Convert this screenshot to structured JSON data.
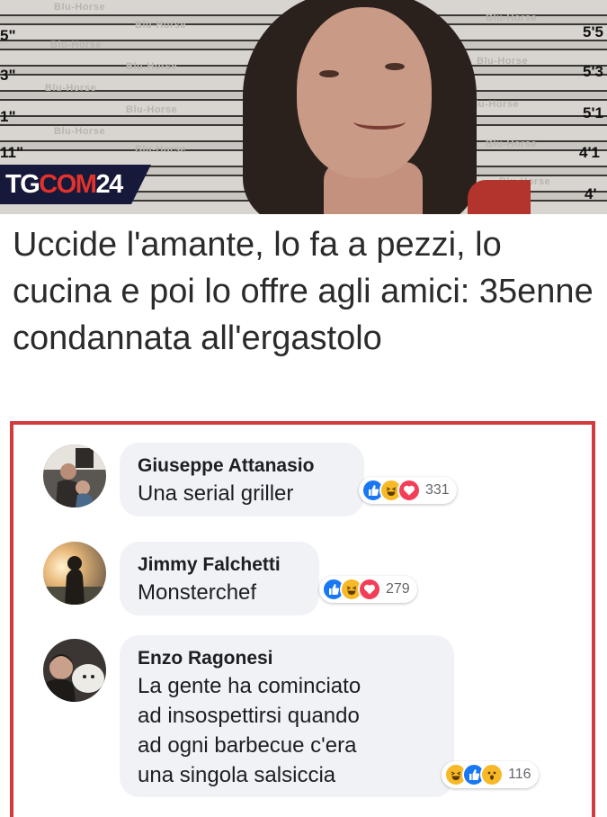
{
  "post": {
    "source_logo": {
      "part1": "TG",
      "part2": "COM",
      "part3": "24"
    },
    "photo": {
      "watermark": "Blu-Horse",
      "height_marks_left": [
        "5\"",
        "3\"",
        "1\"",
        "11\""
      ],
      "height_marks_right": [
        "5'5",
        "5'3",
        "5'1",
        "4'1",
        "4'"
      ]
    },
    "headline": "Uccide l'amante, lo fa a pezzi, lo cucina e poi lo offre agli amici: 35enne condannata all'ergastolo"
  },
  "comments": [
    {
      "author": "Giuseppe Attanasio",
      "text": "Una serial griller",
      "reactions": [
        "like",
        "haha",
        "love"
      ],
      "reaction_count": "331"
    },
    {
      "author": "Jimmy Falchetti",
      "text": "Monsterchef",
      "reactions": [
        "like",
        "haha",
        "love"
      ],
      "reaction_count": "279"
    },
    {
      "author": "Enzo Ragonesi",
      "text": "La gente ha cominciato\nad insospettirsi quando\nad ogni barbecue c'era\nuna singola salsiccia",
      "reactions": [
        "haha",
        "like",
        "wow"
      ],
      "reaction_count": "116"
    }
  ],
  "colors": {
    "frame_red": "#d23b3e",
    "logo_navy": "#16193a",
    "logo_red": "#e3322b",
    "bubble_bg": "#f0f2f5",
    "like_blue": "#1877f2",
    "love_red": "#f33e58",
    "haha_yellow": "#f7b928"
  }
}
